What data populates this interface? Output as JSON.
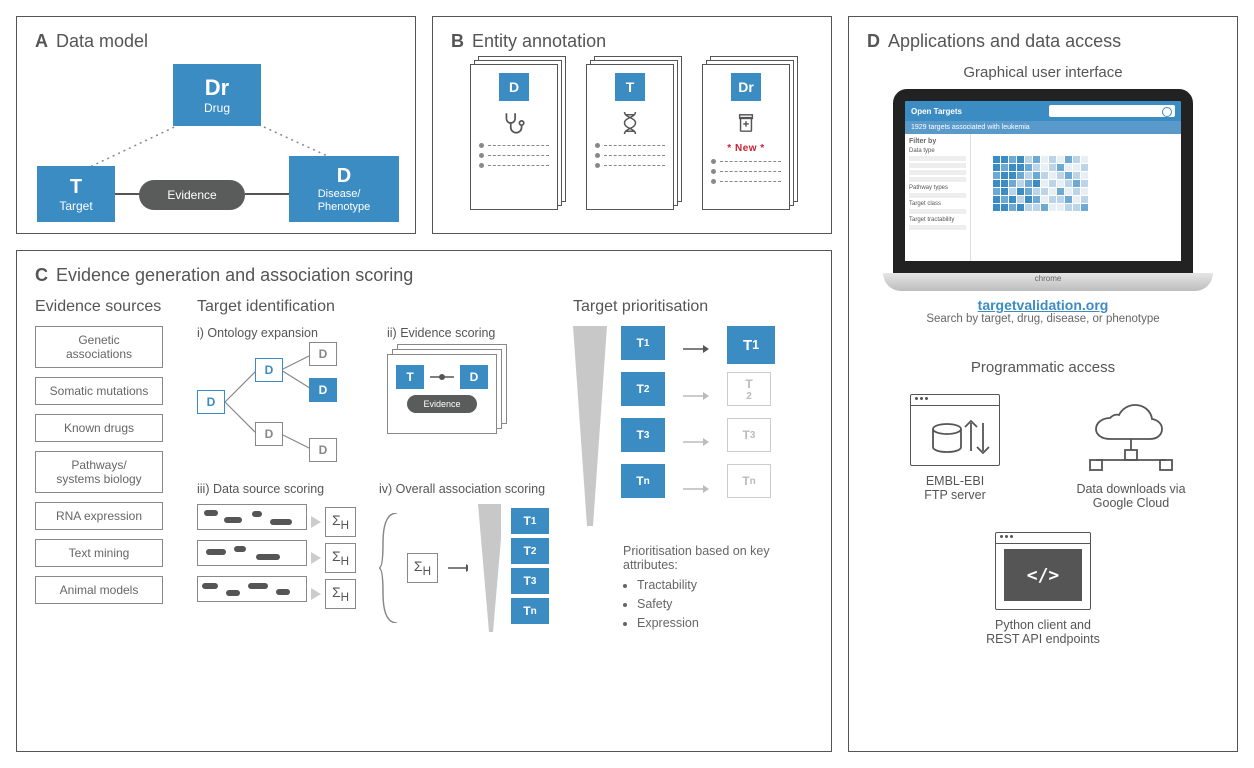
{
  "panels": {
    "A": {
      "letter": "A",
      "title": "Data model",
      "drug": {
        "code": "Dr",
        "label": "Drug"
      },
      "target": {
        "code": "T",
        "label": "Target"
      },
      "disease": {
        "code": "D",
        "label": "Disease/\nPhenotype"
      },
      "evidence": "Evidence"
    },
    "B": {
      "letter": "B",
      "title": "Entity annotation",
      "cards": [
        {
          "code": "D",
          "icon": "stethoscope-icon"
        },
        {
          "code": "T",
          "icon": "dna-icon"
        },
        {
          "code": "Dr",
          "icon": "pill-bottle-icon",
          "tag": "* New *"
        }
      ]
    },
    "C": {
      "letter": "C",
      "title": "Evidence generation and association scoring",
      "sources_head": "Evidence sources",
      "sources": [
        "Genetic associations",
        "Somatic mutations",
        "Known drugs",
        "Pathways/\nsystems biology",
        "RNA expression",
        "Text mining",
        "Animal models"
      ],
      "tid_head": "Target identification",
      "steps": {
        "i": "i) Ontology expansion",
        "ii": "ii) Evidence scoring",
        "iii": "iii) Data source scoring",
        "iv": "iv) Overall association scoring"
      },
      "evidence": "Evidence",
      "sigma": "Σ",
      "sigma_sub": "H",
      "T": "T",
      "D": "D",
      "prio_head": "Target prioritisation",
      "prio_text": "Prioritisation based on key attributes:",
      "prio_items": [
        "Tractability",
        "Safety",
        "Expression"
      ],
      "tsub": [
        "1",
        "2",
        "3",
        "n"
      ]
    },
    "D": {
      "letter": "D",
      "title": "Applications and data access",
      "gui": "Graphical user interface",
      "laptop": {
        "brand": "Open Targets",
        "headline": "1929 targets associated with leukemia",
        "filter": "Filter by",
        "groups": [
          "Data type",
          "Pathway types",
          "Target class",
          "Target tractability"
        ]
      },
      "link": "targetvalidation.org",
      "tagline": "Search by target, drug, disease, or phenotype",
      "prog": "Programmatic access",
      "ftp": "EMBL-EBI\nFTP server",
      "gcloud": "Data downloads via\nGoogle Cloud",
      "api": "Python client and\nREST API endpoints"
    }
  }
}
